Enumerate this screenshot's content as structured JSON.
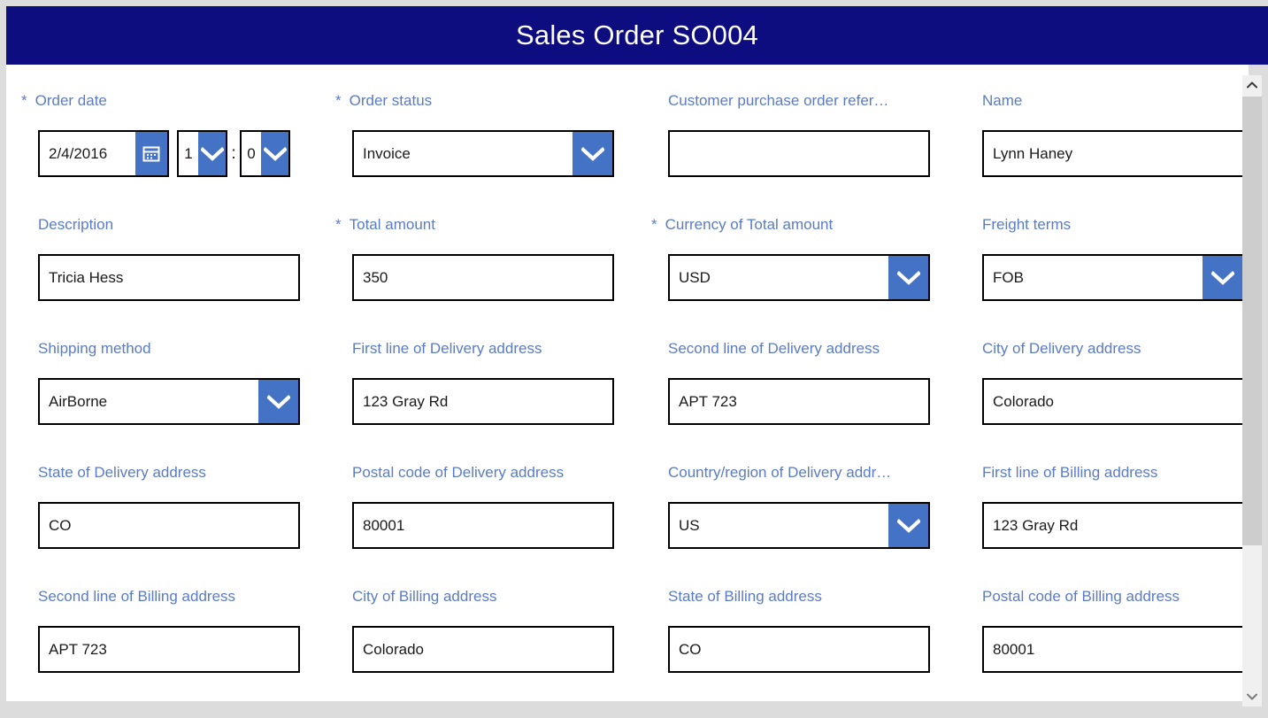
{
  "window": {
    "title": "Sales Order SO004",
    "header_bg": "#0d0d80",
    "accent_blue": "#4472c4",
    "label_color": "#5b7bc4",
    "surface_bg": "#ffffff",
    "page_bg": "#dcdcdc"
  },
  "form": {
    "required_marker": "*",
    "time_separator": ":",
    "rows": [
      {
        "fields": [
          {
            "type": "datetime",
            "required": true,
            "label": "Order date",
            "date_value": "2/4/2016",
            "hour_value": "1",
            "minute_value": "0",
            "calendar_icon": "calendar-icon"
          },
          {
            "type": "dropdown",
            "required": true,
            "label": "Order status",
            "value": "Invoice",
            "icon": "chevron-down-icon"
          },
          {
            "type": "text",
            "required": false,
            "label": "Customer purchase order refer…",
            "value": "",
            "placeholder": ""
          },
          {
            "type": "text",
            "required": false,
            "label": "Name",
            "value": "Lynn Haney",
            "placeholder": ""
          }
        ]
      },
      {
        "fields": [
          {
            "type": "text",
            "required": false,
            "label": "Description",
            "value": "Tricia Hess",
            "placeholder": ""
          },
          {
            "type": "text",
            "required": true,
            "label": "Total amount",
            "value": "350",
            "placeholder": ""
          },
          {
            "type": "dropdown",
            "required": true,
            "label": "Currency of Total amount",
            "value": "USD",
            "icon": "chevron-down-icon"
          },
          {
            "type": "dropdown",
            "required": false,
            "label": "Freight terms",
            "value": "FOB",
            "icon": "chevron-down-icon"
          }
        ]
      },
      {
        "fields": [
          {
            "type": "dropdown",
            "required": false,
            "label": "Shipping method",
            "value": "AirBorne",
            "icon": "chevron-down-icon"
          },
          {
            "type": "text",
            "required": false,
            "label": "First line of Delivery address",
            "value": "123 Gray Rd",
            "placeholder": ""
          },
          {
            "type": "text",
            "required": false,
            "label": "Second line of Delivery address",
            "value": "APT 723",
            "placeholder": ""
          },
          {
            "type": "text",
            "required": false,
            "label": "City of Delivery address",
            "value": "Colorado",
            "placeholder": ""
          }
        ]
      },
      {
        "fields": [
          {
            "type": "text",
            "required": false,
            "label": "State of Delivery address",
            "value": "CO",
            "placeholder": ""
          },
          {
            "type": "text",
            "required": false,
            "label": "Postal code of Delivery address",
            "value": "80001",
            "placeholder": ""
          },
          {
            "type": "dropdown",
            "required": false,
            "label": "Country/region of Delivery addr…",
            "value": "US",
            "icon": "chevron-down-icon"
          },
          {
            "type": "text",
            "required": false,
            "label": "First line of Billing address",
            "value": "123 Gray Rd",
            "placeholder": ""
          }
        ]
      },
      {
        "fields": [
          {
            "type": "text",
            "required": false,
            "label": "Second line of Billing address",
            "value": "APT 723",
            "placeholder": ""
          },
          {
            "type": "text",
            "required": false,
            "label": "City of Billing address",
            "value": "Colorado",
            "placeholder": ""
          },
          {
            "type": "text",
            "required": false,
            "label": "State of Billing address",
            "value": "CO",
            "placeholder": ""
          },
          {
            "type": "text",
            "required": false,
            "label": "Postal code of Billing address",
            "value": "80001",
            "placeholder": ""
          }
        ]
      }
    ]
  },
  "scrollbar": {
    "up_icon": "chevron-up-icon",
    "down_icon": "chevron-down-icon",
    "orientation": "vertical"
  }
}
